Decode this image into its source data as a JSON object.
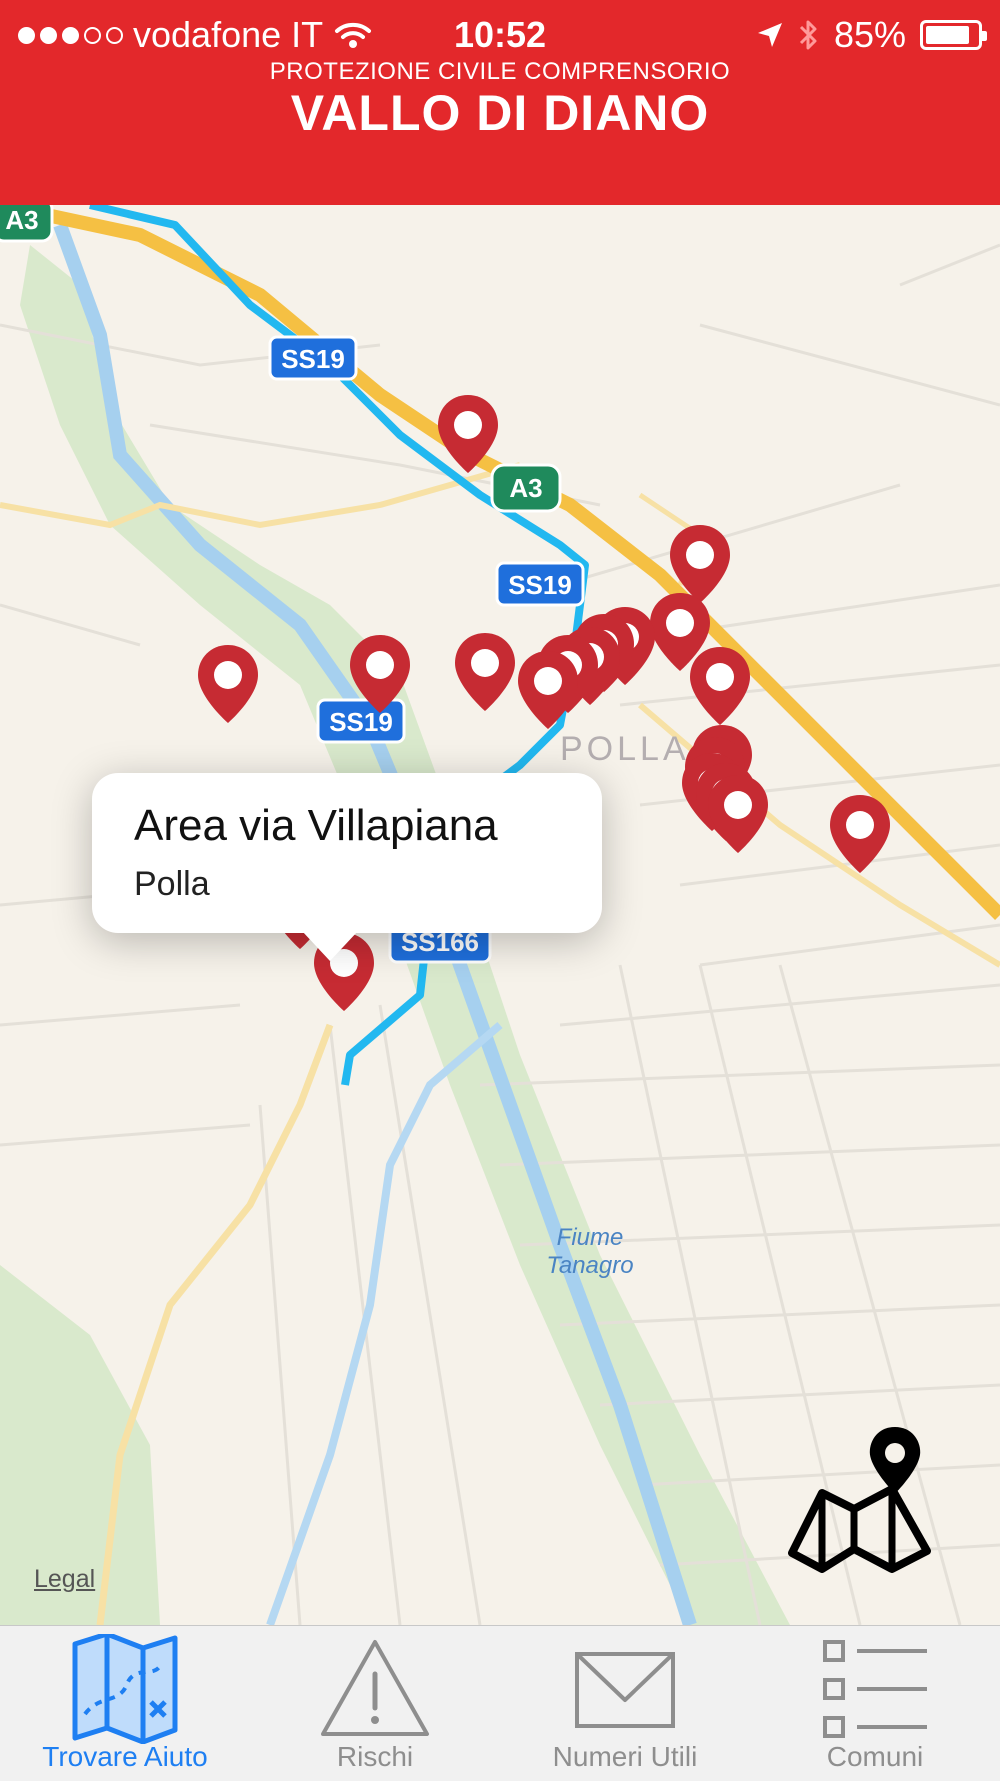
{
  "status": {
    "carrier": "vodafone IT",
    "time": "10:52",
    "battery": "85%",
    "battery_level": 0.85
  },
  "header": {
    "subtitle": "PROTEZIONE CIVILE COMPRENSORIO",
    "title": "VALLO DI DIANO"
  },
  "map": {
    "road_labels": [
      "A3",
      "SS19",
      "A3",
      "SS19",
      "SS19",
      "SS166"
    ],
    "place_label": "POLLA",
    "river_label_line1": "Fiume",
    "river_label_line2": "Tanagro",
    "legal": "Legal",
    "callout": {
      "title": "Area via Villapiana",
      "subtitle": "Polla"
    },
    "pin_color": "#c62b33",
    "route_color": "#22b8f0"
  },
  "tabs": [
    {
      "label": "Trovare Aiuto",
      "icon": "map-icon",
      "active": true
    },
    {
      "label": "Rischi",
      "icon": "warning-icon",
      "active": false
    },
    {
      "label": "Numeri Utili",
      "icon": "envelope-icon",
      "active": false
    },
    {
      "label": "Comuni",
      "icon": "list-icon",
      "active": false
    }
  ],
  "colors": {
    "header": "#e3282b",
    "active_tab": "#1e7ff2",
    "inactive_tab": "#8e8e8e"
  }
}
